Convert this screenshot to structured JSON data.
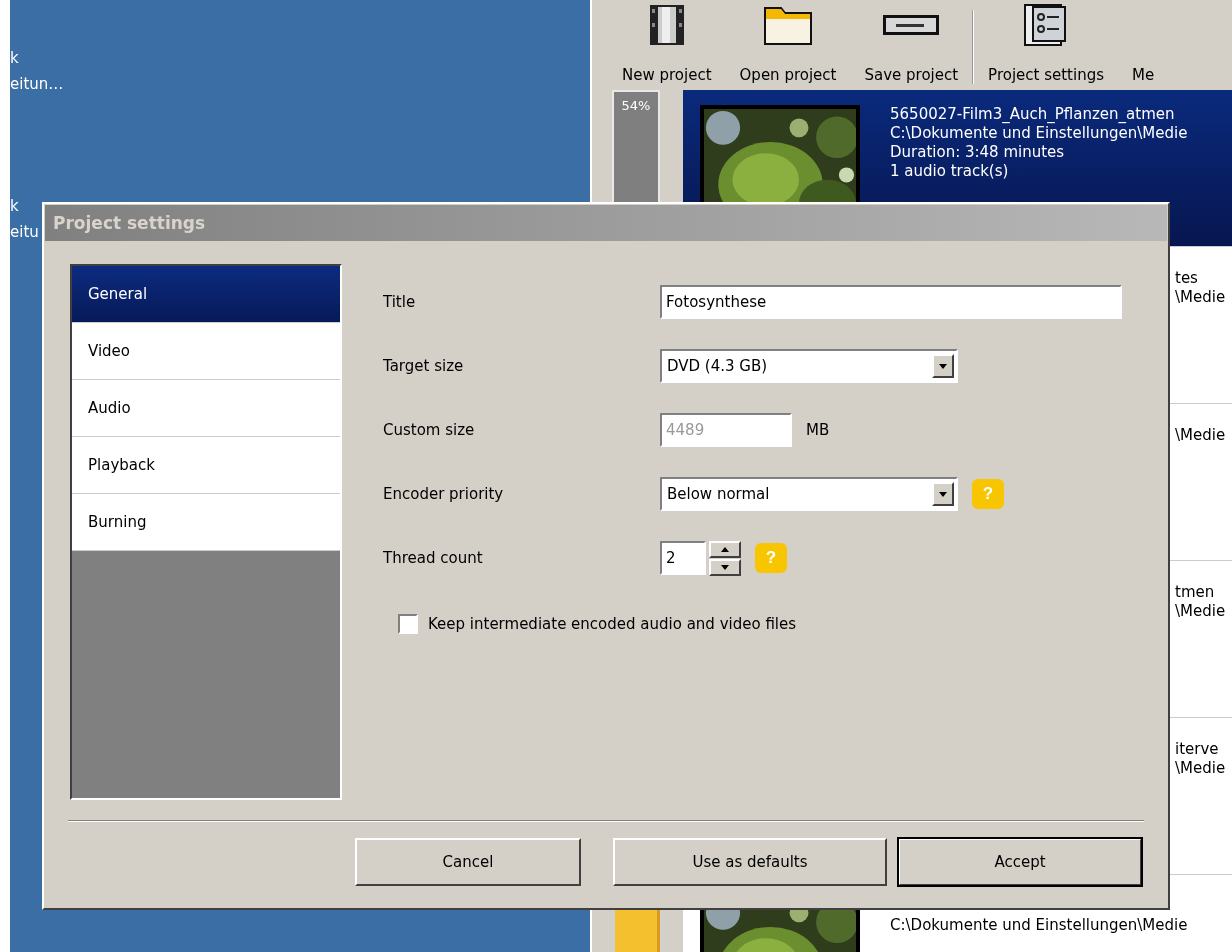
{
  "desktop": {
    "icons": [
      {
        "lines": [
          "k",
          "eitun…"
        ]
      },
      {
        "lines": [
          "k",
          "eitu"
        ]
      }
    ]
  },
  "toolbar": [
    {
      "label": "New project",
      "kind": "film",
      "separator_before": false
    },
    {
      "label": "Open project",
      "kind": "folder",
      "separator_before": false
    },
    {
      "label": "Save project",
      "kind": "drive",
      "separator_before": false
    },
    {
      "label": "Project settings",
      "kind": "settings",
      "separator_before": true
    },
    {
      "label": "Me",
      "kind": "plain",
      "separator_before": false
    }
  ],
  "queue": [
    {
      "kind": "full",
      "selected": true,
      "status": {
        "kind": "progress",
        "label": "54%"
      },
      "lines": [
        "5650027-Film3_Auch_Pflanzen_atmen",
        "C:\\Dokumente und Einstellungen\\Medie",
        "Duration: 3:48 minutes",
        "1 audio track(s)"
      ]
    },
    {
      "kind": "partial",
      "selected": false,
      "lines": [
        "tes",
        "\\Medie"
      ]
    },
    {
      "kind": "partial",
      "selected": false,
      "lines": [
        "\\Medie"
      ]
    },
    {
      "kind": "partial",
      "selected": false,
      "lines": [
        "tmen",
        "\\Medie"
      ]
    },
    {
      "kind": "partial",
      "selected": false,
      "lines": [
        "iterve",
        "\\Medie"
      ]
    },
    {
      "kind": "full",
      "selected": false,
      "status": {
        "kind": "waiting"
      },
      "lines": [
        "C:\\Dokumente und Einstellungen\\Medie"
      ]
    }
  ],
  "dialog": {
    "title": "Project settings",
    "nav": [
      {
        "label": "General",
        "selected": true
      },
      {
        "label": "Video",
        "selected": false
      },
      {
        "label": "Audio",
        "selected": false
      },
      {
        "label": "Playback",
        "selected": false
      },
      {
        "label": "Burning",
        "selected": false
      }
    ],
    "fields": [
      {
        "kind": "text",
        "label": "Title",
        "value": "Fotosynthese",
        "disabled": false
      },
      {
        "kind": "select",
        "label": "Target size",
        "value": "DVD (4.3 GB)",
        "disabled": false
      },
      {
        "kind": "number",
        "label": "Custom size",
        "value": "4489",
        "unit": "MB",
        "disabled": true
      },
      {
        "kind": "select",
        "label": "Encoder priority",
        "value": "Below normal",
        "disabled": false,
        "help": "?"
      },
      {
        "kind": "spin",
        "label": "Thread count",
        "value": "2",
        "disabled": false,
        "help": "?"
      }
    ],
    "checkbox": {
      "label": "Keep intermediate encoded audio and video files",
      "checked": false
    },
    "buttons": [
      {
        "label": "Cancel",
        "default": false
      },
      {
        "label": "Use as defaults",
        "default": false
      },
      {
        "label": "Accept",
        "default": true
      }
    ]
  }
}
